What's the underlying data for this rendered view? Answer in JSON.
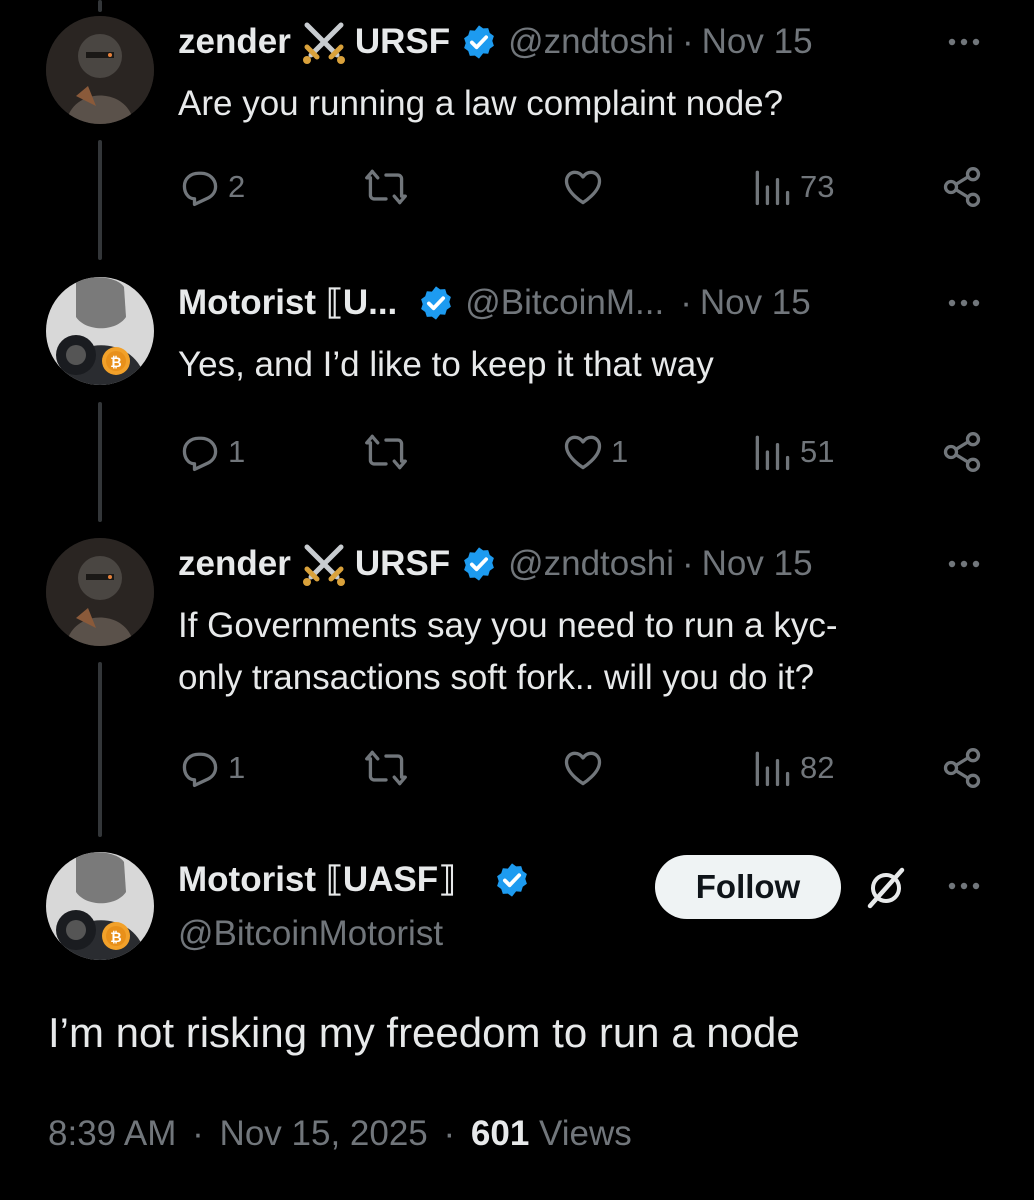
{
  "colors": {
    "background": "#000000",
    "text_primary": "#e7e9ea",
    "text_secondary": "#71767b",
    "verified": "#1d9bf0",
    "thread_line": "#333639",
    "follow_bg": "#eff3f4"
  },
  "replies": [
    {
      "name": "zender",
      "name_suffix": "URSF",
      "handle": "@zndtoshi",
      "sep": "·",
      "date": "Nov 15",
      "text": "Are you running a law complaint node?",
      "reply_count": "2",
      "repost_count": "",
      "like_count": "",
      "views_count": "73",
      "icons": [
        "swords-icon",
        "verified-badge-icon"
      ]
    },
    {
      "name": "Motorist ⟦U...",
      "handle": "@BitcoinM...",
      "sep": "·",
      "date": "Nov 15",
      "text": "Yes, and I’d like to keep it that way",
      "reply_count": "1",
      "repost_count": "",
      "like_count": "1",
      "views_count": "51",
      "icons": [
        "verified-badge-icon"
      ]
    },
    {
      "name": "zender",
      "name_suffix": "URSF",
      "handle": "@zndtoshi",
      "sep": "·",
      "date": "Nov 15",
      "text_line1": "If Governments say you need to run a kyc-",
      "text_line2": "only transactions soft fork.. will you do it?",
      "reply_count": "1",
      "repost_count": "",
      "like_count": "",
      "views_count": "82",
      "icons": [
        "swords-icon",
        "verified-badge-icon"
      ]
    }
  ],
  "main_post": {
    "name": "Motorist ⟦UASF⟧",
    "handle": "@BitcoinMotorist",
    "follow_label": "Follow",
    "text": "I’m not risking my freedom to run a node",
    "time": "8:39 AM",
    "sep1": "·",
    "date": "Nov 15, 2025",
    "sep2": "·",
    "views_count": "601",
    "views_label": "Views"
  }
}
